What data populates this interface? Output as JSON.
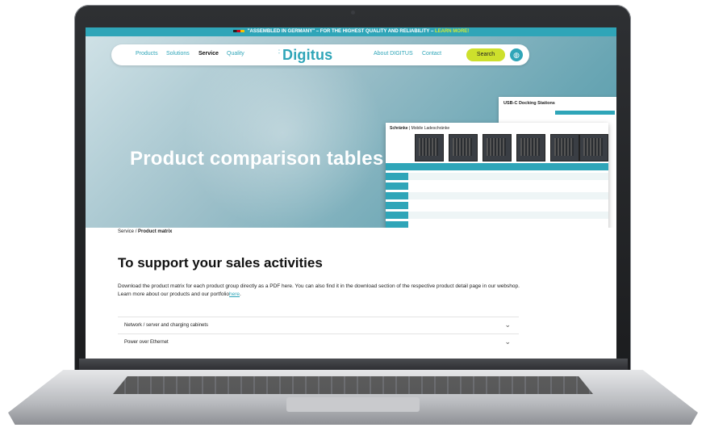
{
  "announcement": {
    "text": "\"ASSEMBLED IN GERMANY\" – FOR THE HIGHEST QUALITY AND RELIABILITY – ",
    "link": "LEARN MORE!"
  },
  "nav": {
    "items": [
      "Products",
      "Solutions",
      "Service",
      "Quality"
    ],
    "logo": "Digitus",
    "right_items": [
      "About DIGITUS",
      "Contact"
    ],
    "search_label": "Search",
    "globe_icon": "globe-icon"
  },
  "hero": {
    "title": "Product comparison tables",
    "doc_back_title": "USB-C Docking Stations",
    "doc_front_title_bold": "Schränke",
    "doc_front_title_rest": " | Mobile Ladeschränke"
  },
  "breadcrumb": {
    "parent": "Service",
    "separator": "/",
    "current": "Product matrix"
  },
  "content": {
    "heading": "To support your sales activities",
    "intro": "Download the product matrix for each product group directly as a PDF here. You can also find it in the download section of the respective product detail page in our webshop. Learn more about our products and our portfolio",
    "intro_link": "here",
    "intro_end": "."
  },
  "accordion": [
    {
      "label": "Network / server and charging cabinets"
    },
    {
      "label": "Power over Ethernet"
    }
  ],
  "colors": {
    "brand": "#2fa5b8",
    "accent": "#cde02c"
  }
}
